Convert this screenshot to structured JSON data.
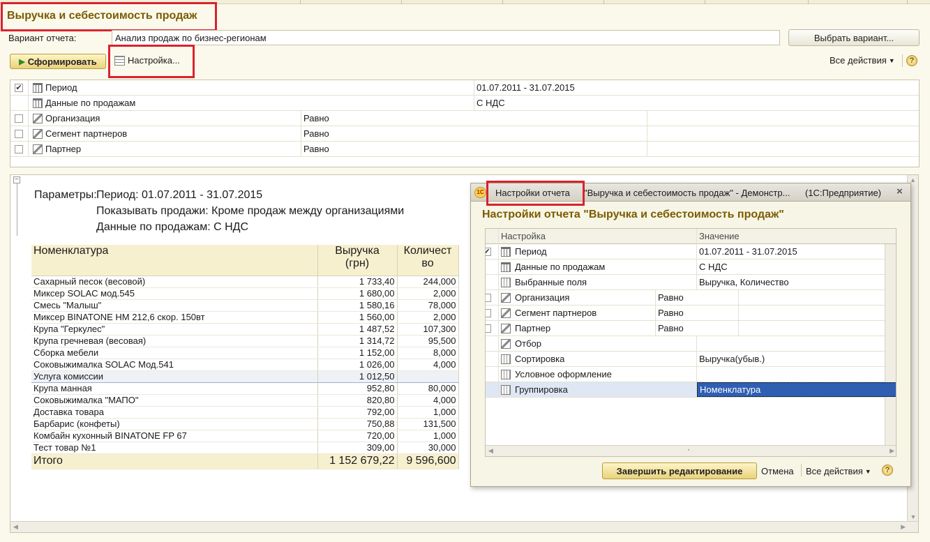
{
  "page_title": "Выручка и себестоимость продаж",
  "variant": {
    "label": "Вариант отчета:",
    "value": "Анализ продаж по бизнес-регионам",
    "select_button": "Выбрать вариант..."
  },
  "toolbar": {
    "generate": "Сформировать",
    "settings": "Настройка...",
    "all_actions": "Все действия",
    "help": "?"
  },
  "filters": [
    {
      "checked": true,
      "label": "Период",
      "condition": "",
      "value": "01.07.2011 - 31.07.2015",
      "has_checkbox": true,
      "icon": "calendar-icon"
    },
    {
      "checked": false,
      "label": "Данные по продажам",
      "condition": "",
      "value": "С НДС",
      "has_checkbox": false,
      "icon": "calendar-icon"
    },
    {
      "checked": false,
      "label": "Организация",
      "condition": "Равно",
      "value": "",
      "has_checkbox": true,
      "icon": "filter-icon"
    },
    {
      "checked": false,
      "label": "Сегмент партнеров",
      "condition": "Равно",
      "value": "",
      "has_checkbox": true,
      "icon": "filter-icon"
    },
    {
      "checked": false,
      "label": "Партнер",
      "condition": "Равно",
      "value": "",
      "has_checkbox": true,
      "icon": "filter-icon"
    }
  ],
  "report": {
    "params_label": "Параметры:",
    "params": [
      "Период: 01.07.2011 - 31.07.2015",
      "Показывать продажи: Кроме продаж между организациями",
      "Данные по продажам: С НДС"
    ],
    "headers": {
      "item": "Номенклатура",
      "revenue_1": "Выручка",
      "revenue_2": "(грн)",
      "qty_1": "Количест",
      "qty_2": "во"
    },
    "rows": [
      {
        "item": "Сахарный песок (весовой)",
        "revenue": "1 733,40",
        "qty": "244,000"
      },
      {
        "item": "Миксер SOLAC мод.545",
        "revenue": "1 680,00",
        "qty": "2,000"
      },
      {
        "item": "Смесь \"Малыш\"",
        "revenue": "1 580,16",
        "qty": "78,000"
      },
      {
        "item": "Миксер BINATONE HM 212,6 скор. 150вт",
        "revenue": "1 560,00",
        "qty": "2,000"
      },
      {
        "item": "Крупа \"Геркулес\"",
        "revenue": "1 487,52",
        "qty": "107,300"
      },
      {
        "item": "Крупа гречневая (весовая)",
        "revenue": "1 314,72",
        "qty": "95,500"
      },
      {
        "item": "Сборка мебели",
        "revenue": "1 152,00",
        "qty": "8,000"
      },
      {
        "item": "Соковыжималка  SOLAC  Мод.541",
        "revenue": "1 026,00",
        "qty": "4,000"
      },
      {
        "item": "Услуга комиссии",
        "revenue": "1 012,50",
        "qty": ""
      },
      {
        "item": "Крупа манная",
        "revenue": "952,80",
        "qty": "80,000"
      },
      {
        "item": "Соковыжималка \"МАПО\"",
        "revenue": "820,80",
        "qty": "4,000"
      },
      {
        "item": "Доставка товара",
        "revenue": "792,00",
        "qty": "1,000"
      },
      {
        "item": "Барбарис (конфеты)",
        "revenue": "750,88",
        "qty": "131,500"
      },
      {
        "item": "Комбайн кухонный BINATONE FP 67",
        "revenue": "720,00",
        "qty": "1,000"
      },
      {
        "item": "Тест товар №1",
        "revenue": "309,00",
        "qty": "30,000"
      }
    ],
    "total": {
      "label": "Итого",
      "revenue": "1 152 679,22",
      "qty": "9 596,600"
    }
  },
  "dialog": {
    "tab_label": "Настройки отчета",
    "title_rest": "\"Выручка и себестоимость продаж\" - Демонстр...",
    "app_name": "(1С:Предприятие)",
    "heading": "Настройки отчета \"Выручка и себестоимость продаж\"",
    "col_setting": "Настройка",
    "col_value": "Значение",
    "rows": [
      {
        "label": "Период",
        "condition": "",
        "value": "01.07.2011 - 31.07.2015",
        "checkbox": "checked",
        "icon": "calendar-icon"
      },
      {
        "label": "Данные по продажам",
        "condition": "",
        "value": "С НДС",
        "checkbox": "none",
        "icon": "calendar-icon"
      },
      {
        "label": "Выбранные поля",
        "condition": "",
        "value": "Выручка, Количество",
        "checkbox": "none",
        "icon": "fields-icon"
      },
      {
        "label": "Организация",
        "condition": "Равно",
        "value": "",
        "checkbox": "unchecked",
        "icon": "filter-icon"
      },
      {
        "label": "Сегмент партнеров",
        "condition": "Равно",
        "value": "",
        "checkbox": "unchecked",
        "icon": "filter-icon"
      },
      {
        "label": "Партнер",
        "condition": "Равно",
        "value": "",
        "checkbox": "unchecked",
        "icon": "filter-icon"
      },
      {
        "label": "Отбор",
        "condition": "",
        "value": "",
        "checkbox": "none",
        "icon": "filter-icon"
      },
      {
        "label": "Сортировка",
        "condition": "",
        "value": "Выручка(убыв.)",
        "checkbox": "none",
        "icon": "sort-icon"
      },
      {
        "label": "Условное оформление",
        "condition": "",
        "value": "",
        "checkbox": "none",
        "icon": "format-icon"
      },
      {
        "label": "Группировка",
        "condition": "",
        "value": "Номенклатура",
        "checkbox": "none",
        "icon": "grouping-icon",
        "selected": true
      }
    ],
    "finish_button": "Завершить редактирование",
    "cancel": "Отмена",
    "all_actions": "Все действия",
    "help": "?",
    "logo": "1С"
  }
}
